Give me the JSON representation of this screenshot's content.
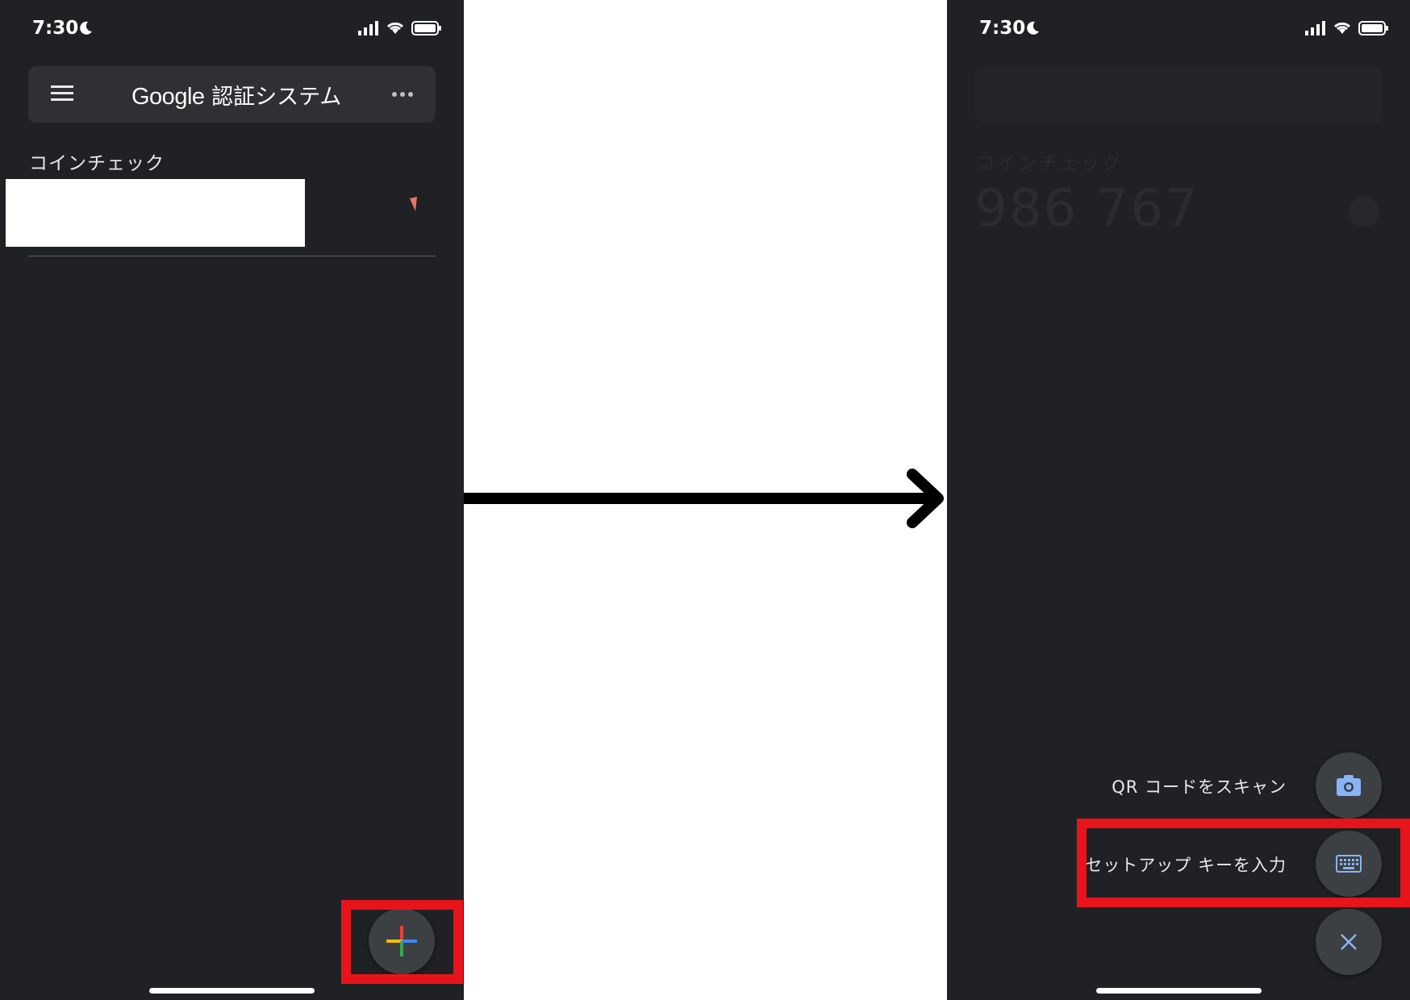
{
  "left_screen": {
    "status_bar": {
      "time": "7:30"
    },
    "app_bar": {
      "title_brand": "Google",
      "title_suffix": "認証システム"
    },
    "account": {
      "name": "コインチェック"
    }
  },
  "right_screen": {
    "status_bar": {
      "time": "7:30"
    },
    "dimmed_account": {
      "name": "コインチェック",
      "code": "986 767"
    },
    "add_menu": {
      "scan_qr_label": "QR コードをスキャン",
      "enter_key_label": "セットアップ キーを入力"
    }
  },
  "colors": {
    "background": "#202124",
    "highlight": "#e8141b",
    "plus_red": "#ea4335",
    "plus_yellow": "#fbbc04",
    "plus_green": "#34a853",
    "plus_blue": "#4285f4",
    "menu_icon_blue": "#8ab4f8"
  },
  "icons": [
    "moon-icon",
    "signal-icon",
    "wifi-icon",
    "battery-icon",
    "menu-icon",
    "more-icon",
    "timer-icon",
    "plus-icon",
    "camera-icon",
    "keyboard-icon",
    "close-icon",
    "arrow-icon"
  ]
}
